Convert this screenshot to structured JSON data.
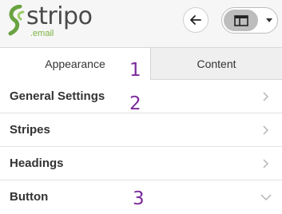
{
  "brand": {
    "name": "stripo",
    "suffix": ".email"
  },
  "toolbar": {
    "back_icon": "arrow-left-icon",
    "layout_icon": "layout-panel-icon",
    "caret_icon": "caret-down-icon"
  },
  "tabs": [
    {
      "label": "Appearance",
      "active": true
    },
    {
      "label": "Content",
      "active": false
    }
  ],
  "sections": [
    {
      "label": "General Settings",
      "state": "collapsed"
    },
    {
      "label": "Stripes",
      "state": "collapsed"
    },
    {
      "label": "Headings",
      "state": "collapsed"
    },
    {
      "label": "Button",
      "state": "expanded"
    }
  ],
  "annotations": [
    "1",
    "2",
    "3"
  ],
  "colors": {
    "brand_green": "#7cb342",
    "annotation": "#7b2a9a",
    "topbar_bg": "#f6f6f6",
    "inactive_tab_bg": "#efefef"
  }
}
